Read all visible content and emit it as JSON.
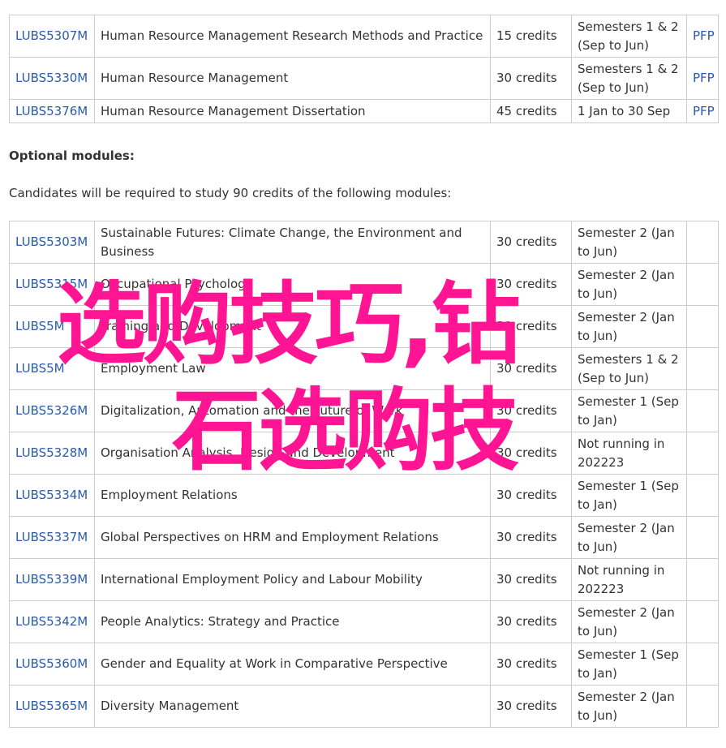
{
  "core_modules": [
    {
      "code": "LUBS5307M",
      "title": "Human Resource Management Research Methods and Practice",
      "credits": "15 credits",
      "semester": "Semesters 1 & 2 (Sep to Jun)",
      "pfp": "PFP"
    },
    {
      "code": "LUBS5330M",
      "title": "Human Resource Management",
      "credits": "30 credits",
      "semester": "Semesters 1 & 2 (Sep to Jun)",
      "pfp": "PFP"
    },
    {
      "code": "LUBS5376M",
      "title": "Human Resource Management Dissertation",
      "credits": "45 credits",
      "semester": "1 Jan to 30 Sep",
      "pfp": "PFP"
    }
  ],
  "optional_section": {
    "heading": "Optional modules:",
    "intro": "Candidates will be required to study 90 credits of the following modules:"
  },
  "optional_modules": [
    {
      "code": "LUBS5303M",
      "title": "Sustainable Futures: Climate Change, the Environment and Business",
      "credits": "30 credits",
      "semester": "Semester 2 (Jan to Jun)"
    },
    {
      "code": "LUBS5315M",
      "title": "Occupational Psychology",
      "credits": "30 credits",
      "semester": "Semester 2 (Jan to Jun)"
    },
    {
      "code": "LUBS5M",
      "title": "Training and Development",
      "credits": "30 credits",
      "semester": "Semester 2 (Jan to Jun)"
    },
    {
      "code": "LUBS5M",
      "title": "Employment Law",
      "credits": "30 credits",
      "semester": "Semesters 1 & 2 (Sep to Jun)"
    },
    {
      "code": "LUBS5326M",
      "title": "Digitalization, Automation and the Future of Work",
      "credits": "30 credits",
      "semester": "Semester 1 (Sep to Jan)"
    },
    {
      "code": "LUBS5328M",
      "title": "Organisation Analysis, Design and Development",
      "credits": "30 credits",
      "semester": "Not running in 202223"
    },
    {
      "code": "LUBS5334M",
      "title": "Employment Relations",
      "credits": "30 credits",
      "semester": "Semester 1 (Sep to Jan)"
    },
    {
      "code": "LUBS5337M",
      "title": "Global Perspectives on HRM and Employment Relations",
      "credits": "30 credits",
      "semester": "Semester 2 (Jan to Jun)"
    },
    {
      "code": "LUBS5339M",
      "title": "International Employment Policy and Labour Mobility",
      "credits": "30 credits",
      "semester": "Not running in 202223"
    },
    {
      "code": "LUBS5342M",
      "title": "People Analytics: Strategy and Practice",
      "credits": "30 credits",
      "semester": "Semester 2 (Jan to Jun)"
    },
    {
      "code": "LUBS5360M",
      "title": "Gender and Equality at Work in Comparative Perspective",
      "credits": "30 credits",
      "semester": "Semester 1 (Sep to Jan)"
    },
    {
      "code": "LUBS5365M",
      "title": "Diversity Management",
      "credits": "30 credits",
      "semester": "Semester 2 (Jan to Jun)"
    }
  ],
  "overlay": {
    "line1": "选购技巧,钻",
    "line2": "石选购技"
  },
  "colors": {
    "link": "#2a5ba8",
    "border": "#cccccc",
    "text": "#333333",
    "overlay": "#ff1493"
  }
}
